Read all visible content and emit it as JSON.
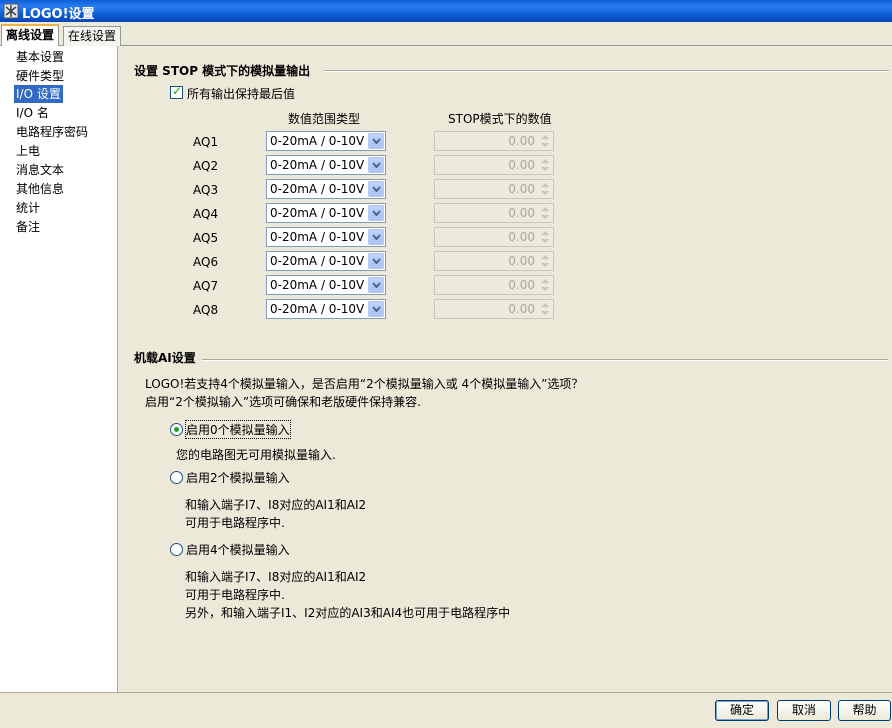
{
  "window": {
    "title": "LOGO!设置"
  },
  "tabs": [
    {
      "label": "离线设置",
      "active": true
    },
    {
      "label": "在线设置",
      "active": false
    }
  ],
  "sidebar": {
    "items": [
      {
        "label": "基本设置"
      },
      {
        "label": "硬件类型"
      },
      {
        "label": "I/O 设置",
        "selected": true
      },
      {
        "label": "I/O 名"
      },
      {
        "label": "电路程序密码"
      },
      {
        "label": "上电"
      },
      {
        "label": "消息文本"
      },
      {
        "label": "其他信息"
      },
      {
        "label": "统计"
      },
      {
        "label": "备注"
      }
    ]
  },
  "stop_group": {
    "title": "设置 STOP 模式下的模拟量输出",
    "keep_last_label": "所有输出保持最后值",
    "keep_last_checked": true,
    "col_range": "数值范围类型",
    "col_stop": "STOP模式下的数值",
    "rows": [
      {
        "name": "AQ1",
        "range": "0-20mA / 0-10V",
        "value": "0.00"
      },
      {
        "name": "AQ2",
        "range": "0-20mA / 0-10V",
        "value": "0.00"
      },
      {
        "name": "AQ3",
        "range": "0-20mA / 0-10V",
        "value": "0.00"
      },
      {
        "name": "AQ4",
        "range": "0-20mA / 0-10V",
        "value": "0.00"
      },
      {
        "name": "AQ5",
        "range": "0-20mA / 0-10V",
        "value": "0.00"
      },
      {
        "name": "AQ6",
        "range": "0-20mA / 0-10V",
        "value": "0.00"
      },
      {
        "name": "AQ7",
        "range": "0-20mA / 0-10V",
        "value": "0.00"
      },
      {
        "name": "AQ8",
        "range": "0-20mA / 0-10V",
        "value": "0.00"
      }
    ]
  },
  "ai_group": {
    "title": "机载AI设置",
    "desc1": "LOGO!若支持4个模拟量输入，是否启用“2个模拟量输入或 4个模拟量输入”选项？",
    "desc2": "启用“2个模拟输入”选项可确保和老版硬件保持兼容.",
    "options": [
      {
        "label": "启用0个模拟量输入",
        "selected": true,
        "notes": [
          "您的电路图无可用模拟量输入."
        ]
      },
      {
        "label": "启用2个模拟量输入",
        "selected": false,
        "notes": [
          "和输入端子I7、I8对应的AI1和AI2",
          "可用于电路程序中."
        ]
      },
      {
        "label": "启用4个模拟量输入",
        "selected": false,
        "notes": [
          "和输入端子I7、I8对应的AI1和AI2",
          "可用于电路程序中.",
          "另外，和输入端子I1、I2对应的AI3和AI4也可用于电路程序中"
        ]
      }
    ]
  },
  "buttons": {
    "ok": "确定",
    "cancel": "取消",
    "help": "帮助"
  },
  "colors": {
    "selection": "#316ac5",
    "titlebar": "#0a5fd8",
    "checkmark": "#21a121"
  }
}
